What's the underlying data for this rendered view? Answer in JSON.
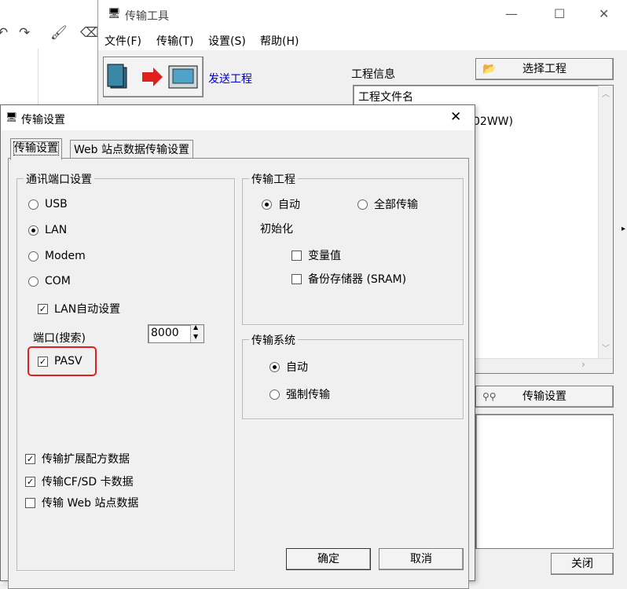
{
  "tool_window": {
    "title": "传输工具",
    "menu": [
      "文件(F)",
      "传输(T)",
      "设置(S)",
      "帮助(H)"
    ],
    "send_project_label": "发送工程",
    "project_info_label": "工程信息",
    "select_project_button": "选择工程",
    "project_list_text": "工程文件名",
    "partial_text": "02WW)",
    "transfer_settings_button": "传输设置",
    "close_button": "关闭"
  },
  "dialog": {
    "title": "传输设置",
    "tabs": [
      "传输设置",
      "Web 站点数据传输设置"
    ],
    "comm_port": {
      "title": "通讯端口设置",
      "options": [
        "USB",
        "LAN",
        "Modem",
        "COM"
      ],
      "selected": "LAN",
      "lan_auto_label": "LAN自动设置",
      "port_label": "端口(搜索)",
      "port_value": "8000",
      "pasv_label": "PASV"
    },
    "transfer_project": {
      "title": "传输工程",
      "auto_label": "自动",
      "all_label": "全部传输",
      "init_label": "初始化",
      "variable_label": "变量值",
      "backup_label": "备份存储器 (SRAM)"
    },
    "transfer_system": {
      "title": "传输系统",
      "auto_label": "自动",
      "force_label": "强制传输"
    },
    "extra_checks": [
      "传输扩展配方数据",
      "传输CF/SD 卡数据",
      "传输 Web 站点数据"
    ],
    "ok_button": "确定",
    "cancel_button": "取消"
  },
  "colors": {
    "highlight": "#e02020",
    "link": "#0000cc"
  }
}
